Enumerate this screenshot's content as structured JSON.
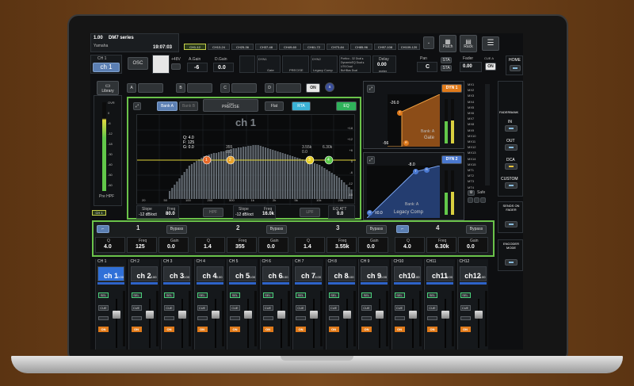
{
  "app": {
    "series_num": "1.00",
    "series_name": "DM7 series",
    "brand": "Yamaha",
    "clock": "19:07:03"
  },
  "top_tabs": [
    "CH1-12",
    "CH13-24",
    "CH25-36",
    "CH37-48",
    "CH49-60",
    "CH61-72",
    "CH73-84",
    "CH85-96",
    "CH97-108",
    "CH109-120"
  ],
  "top_right": {
    "patch": "Patch",
    "rack": "Rack",
    "pan_label": "Pan",
    "pan_value": "C",
    "sta1": "STA",
    "sta2": "STA",
    "fader_label": "Fader",
    "fader_value": "0.00",
    "ms": "CUE A",
    "on": "ON",
    "home": "HOME"
  },
  "channel": {
    "selector": "CH 1",
    "name": "ch 1",
    "osc": "OSC",
    "plus48": "+48V",
    "a_gain_label": "A.Gain",
    "a_gain_value": "-6",
    "d_gain_label": "D.Gain",
    "d_gain_value": "0.0",
    "dyn1": "DYN1",
    "dyn1_sub": "Gate",
    "dyn2": "DYN2",
    "dyn2_sub": "PRECISE",
    "legacy": "Legacy Comp",
    "delay_label": "Delay",
    "delay_value": "0.00",
    "meter_label": "meter",
    "plugins": [
      "Portico - 32 Dual ▸",
      "DynamicEQ Dual ▸",
      "U76 Dual",
      "BuHBas Dual"
    ]
  },
  "library": "Library",
  "insert_on": "ON",
  "eq": {
    "bank_a": "Bank A",
    "bank_b": "Bank B",
    "type_label": "Type",
    "type_value": "PRECISE",
    "flat": "Flat",
    "rta": "RTA",
    "eq": "EQ",
    "title": "ch 1",
    "info": [
      "Q: 4.0",
      "F: 125",
      "G: 0.0"
    ],
    "hpf": "HPF",
    "lpf": "LPF",
    "slope1_label": "Slope",
    "slope1_value": "-12 dB/oct",
    "freq1_label": "Freq",
    "freq1_value": "80.0",
    "slope2_label": "Slope",
    "slope2_value": "-12 dB/oct",
    "freq2_label": "Freq",
    "freq2_value": "16.0k",
    "att_label": "EQ ATT",
    "att_value": "0.0",
    "freq_ticks": [
      "20",
      "50",
      "100",
      "200",
      "500",
      "1k",
      "2k",
      "5k",
      "10k",
      "20k"
    ],
    "db_ticks": [
      "+18",
      "+12",
      "+6",
      "0",
      "-6",
      "-12",
      "-18"
    ],
    "point_labels": [
      "1",
      "2",
      "3",
      "4"
    ],
    "top_labels": [
      "355",
      "3.55k",
      "6.30k"
    ],
    "top_vals": [
      "0.0",
      "0.0"
    ]
  },
  "meter_left": {
    "scale": [
      "OVR",
      "0",
      "-6",
      "-12",
      "-18",
      "-30",
      "-40",
      "-50",
      "-60"
    ],
    "label": "Pre HPF"
  },
  "gate": {
    "name": "DYN 1",
    "title": "Gate",
    "bank": "Bank: A",
    "threshold": "-26.0",
    "range": "-56",
    "scale": [
      "OVR",
      "0",
      "-6",
      "-12",
      "-18",
      "-30",
      "-40",
      "-50",
      "-60"
    ]
  },
  "comp": {
    "name": "DYN 2",
    "title": "Legacy Comp",
    "bank": "Bank: A",
    "threshold": "-8.0",
    "ratio": "±0.0",
    "scale": [
      "OVR",
      "0",
      "-6",
      "-12",
      "-18",
      "-30",
      "-40",
      "-50",
      "-60"
    ]
  },
  "bus_labels": [
    "MX1",
    "MX2",
    "MX3",
    "MX4",
    "MX5",
    "MX6",
    "MX7",
    "MX8",
    "MX9",
    "MX10",
    "MX11",
    "MX12",
    "MX13",
    "MX14",
    "MX15",
    "MT1",
    "MT2",
    "MT3",
    "MT4"
  ],
  "safe": "Safe",
  "faderbank": {
    "title": "FADERBANK",
    "in": "IN",
    "out": "OUT",
    "dca": "DCA",
    "custom": "CUSTOM"
  },
  "sends_on_fader": "SENDS ON FADER",
  "encoder_mode": "ENCODER MODE",
  "ch1_tab": "CH 1",
  "bands": [
    {
      "num": "1",
      "bypass": "Bypass",
      "q_label": "Q",
      "q": "4.0",
      "f_label": "Freq",
      "f": "125",
      "g_label": "Gain",
      "g": "0.0"
    },
    {
      "num": "2",
      "bypass": "Bypass",
      "q_label": "Q",
      "q": "1.4",
      "f_label": "Freq",
      "f": "355",
      "g_label": "Gain",
      "g": "0.0"
    },
    {
      "num": "3",
      "bypass": "Bypass",
      "q_label": "Q",
      "q": "1.4",
      "f_label": "Freq",
      "f": "3.55k",
      "g_label": "Gain",
      "g": "0.0"
    },
    {
      "num": "4",
      "bypass": "Bypass",
      "q_label": "Q",
      "q": "4.0",
      "f_label": "Freq",
      "f": "6.30k",
      "g_label": "Gain",
      "g": "0.0"
    }
  ],
  "channels": [
    {
      "id": "CH 1",
      "name": "ch 1",
      "level": "0.00"
    },
    {
      "id": "CH 2",
      "name": "ch 2",
      "level": "0.00"
    },
    {
      "id": "CH 3",
      "name": "ch 3",
      "level": "0.00"
    },
    {
      "id": "CH 4",
      "name": "ch 4",
      "level": "0.00"
    },
    {
      "id": "CH 5",
      "name": "ch 5",
      "level": "0.00"
    },
    {
      "id": "CH 6",
      "name": "ch 6",
      "level": "0.00"
    },
    {
      "id": "CH 7",
      "name": "ch 7",
      "level": "0.00"
    },
    {
      "id": "CH 8",
      "name": "ch 8",
      "level": "0.00"
    },
    {
      "id": "CH 9",
      "name": "ch 9",
      "level": "0.00"
    },
    {
      "id": "CH10",
      "name": "ch10",
      "level": "0.00"
    },
    {
      "id": "CH11",
      "name": "ch11",
      "level": "0.00"
    },
    {
      "id": "CH12",
      "name": "ch12",
      "level": "0.00"
    }
  ],
  "strip_buttons": {
    "sel": "SEL",
    "cue": "CUE",
    "on": "ON"
  },
  "colors": {
    "accent_green": "#6ac24a",
    "select_blue": "#3070d8",
    "orange": "#e07a1a",
    "bg": "#0e0f11"
  }
}
